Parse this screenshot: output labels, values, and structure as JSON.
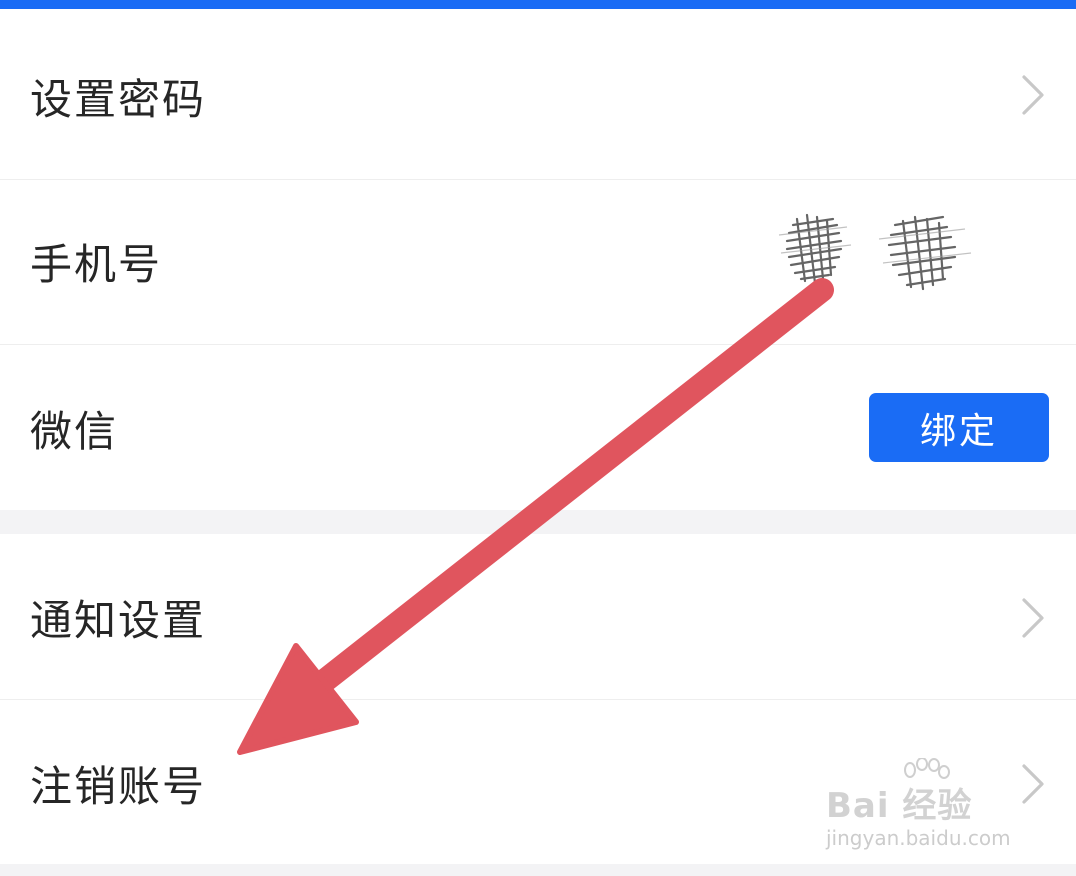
{
  "settings": {
    "rows": [
      {
        "label": "设置密码",
        "accessory": "chevron-right-icon"
      },
      {
        "label": "手机号",
        "accessory": "redacted-phone-number"
      },
      {
        "label": "微信",
        "accessory": "bind-button"
      },
      {
        "label": "通知设置",
        "accessory": "chevron-right-icon"
      },
      {
        "label": "注销账号",
        "accessory": "chevron-right-icon"
      }
    ],
    "bind_label": "绑定"
  },
  "annotation": {
    "arrow_color": "#e0555e",
    "points_to": "注销账号"
  },
  "watermark": {
    "brand": "Bai 经验",
    "url": "jingyan.baidu.com"
  },
  "colors": {
    "accent": "#1a6cf5",
    "text": "#262626",
    "chevron": "#c8c8c8",
    "section_background": "#f3f3f5"
  }
}
